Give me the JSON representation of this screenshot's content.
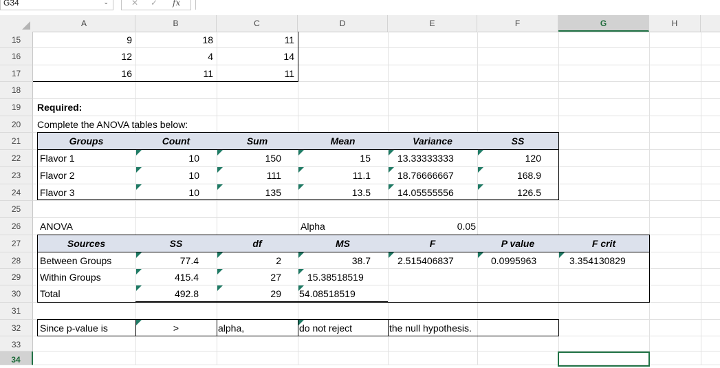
{
  "formula_bar": {
    "name_box": "G34",
    "cancel": "✕",
    "enter": "✓",
    "fx": "fx",
    "formula": ""
  },
  "columns": [
    "A",
    "B",
    "C",
    "D",
    "E",
    "F",
    "G",
    "H"
  ],
  "selected_column": "G",
  "rows": [
    "15",
    "16",
    "17",
    "18",
    "19",
    "20",
    "21",
    "22",
    "23",
    "24",
    "25",
    "26",
    "27",
    "28",
    "29",
    "30",
    "31",
    "32",
    "33",
    "34"
  ],
  "selected_row": "34",
  "data_rows": [
    [
      "9",
      "18",
      "11"
    ],
    [
      "12",
      "4",
      "14"
    ],
    [
      "16",
      "11",
      "11"
    ]
  ],
  "required": "Required:",
  "instruction": "Complete the ANOVA tables below:",
  "summary": {
    "headers": [
      "Groups",
      "Count",
      "Sum",
      "Mean",
      "Variance",
      "SS"
    ],
    "rows": [
      [
        "Flavor 1",
        "10",
        "150",
        "15",
        "13.33333333",
        "120"
      ],
      [
        "Flavor 2",
        "10",
        "111",
        "11.1",
        "18.76666667",
        "168.9"
      ],
      [
        "Flavor 3",
        "10",
        "135",
        "13.5",
        "14.05555556",
        "126.5"
      ]
    ]
  },
  "anova": {
    "label": "ANOVA",
    "alpha_label": "Alpha",
    "alpha_value": "0.05",
    "headers": [
      "Sources",
      "SS",
      "df",
      "MS",
      "F",
      "P value",
      "F crit"
    ],
    "rows": [
      [
        "Between Groups",
        "77.4",
        "2",
        "38.7",
        "2.515406837",
        "0.0995963",
        "3.354130829"
      ],
      [
        "Within Groups",
        "415.4",
        "27",
        "15.38518519",
        "",
        "",
        ""
      ],
      [
        "Total",
        "492.8",
        "29",
        "54.08518519",
        "",
        "",
        ""
      ]
    ]
  },
  "conclusion": [
    "Since p-value is",
    ">",
    "alpha,",
    "do not reject",
    "the null hypothesis."
  ],
  "colors": {
    "header_fill": "#dce1ec",
    "excel_green": "#217346",
    "comment_triangle": "#1f7a64"
  }
}
